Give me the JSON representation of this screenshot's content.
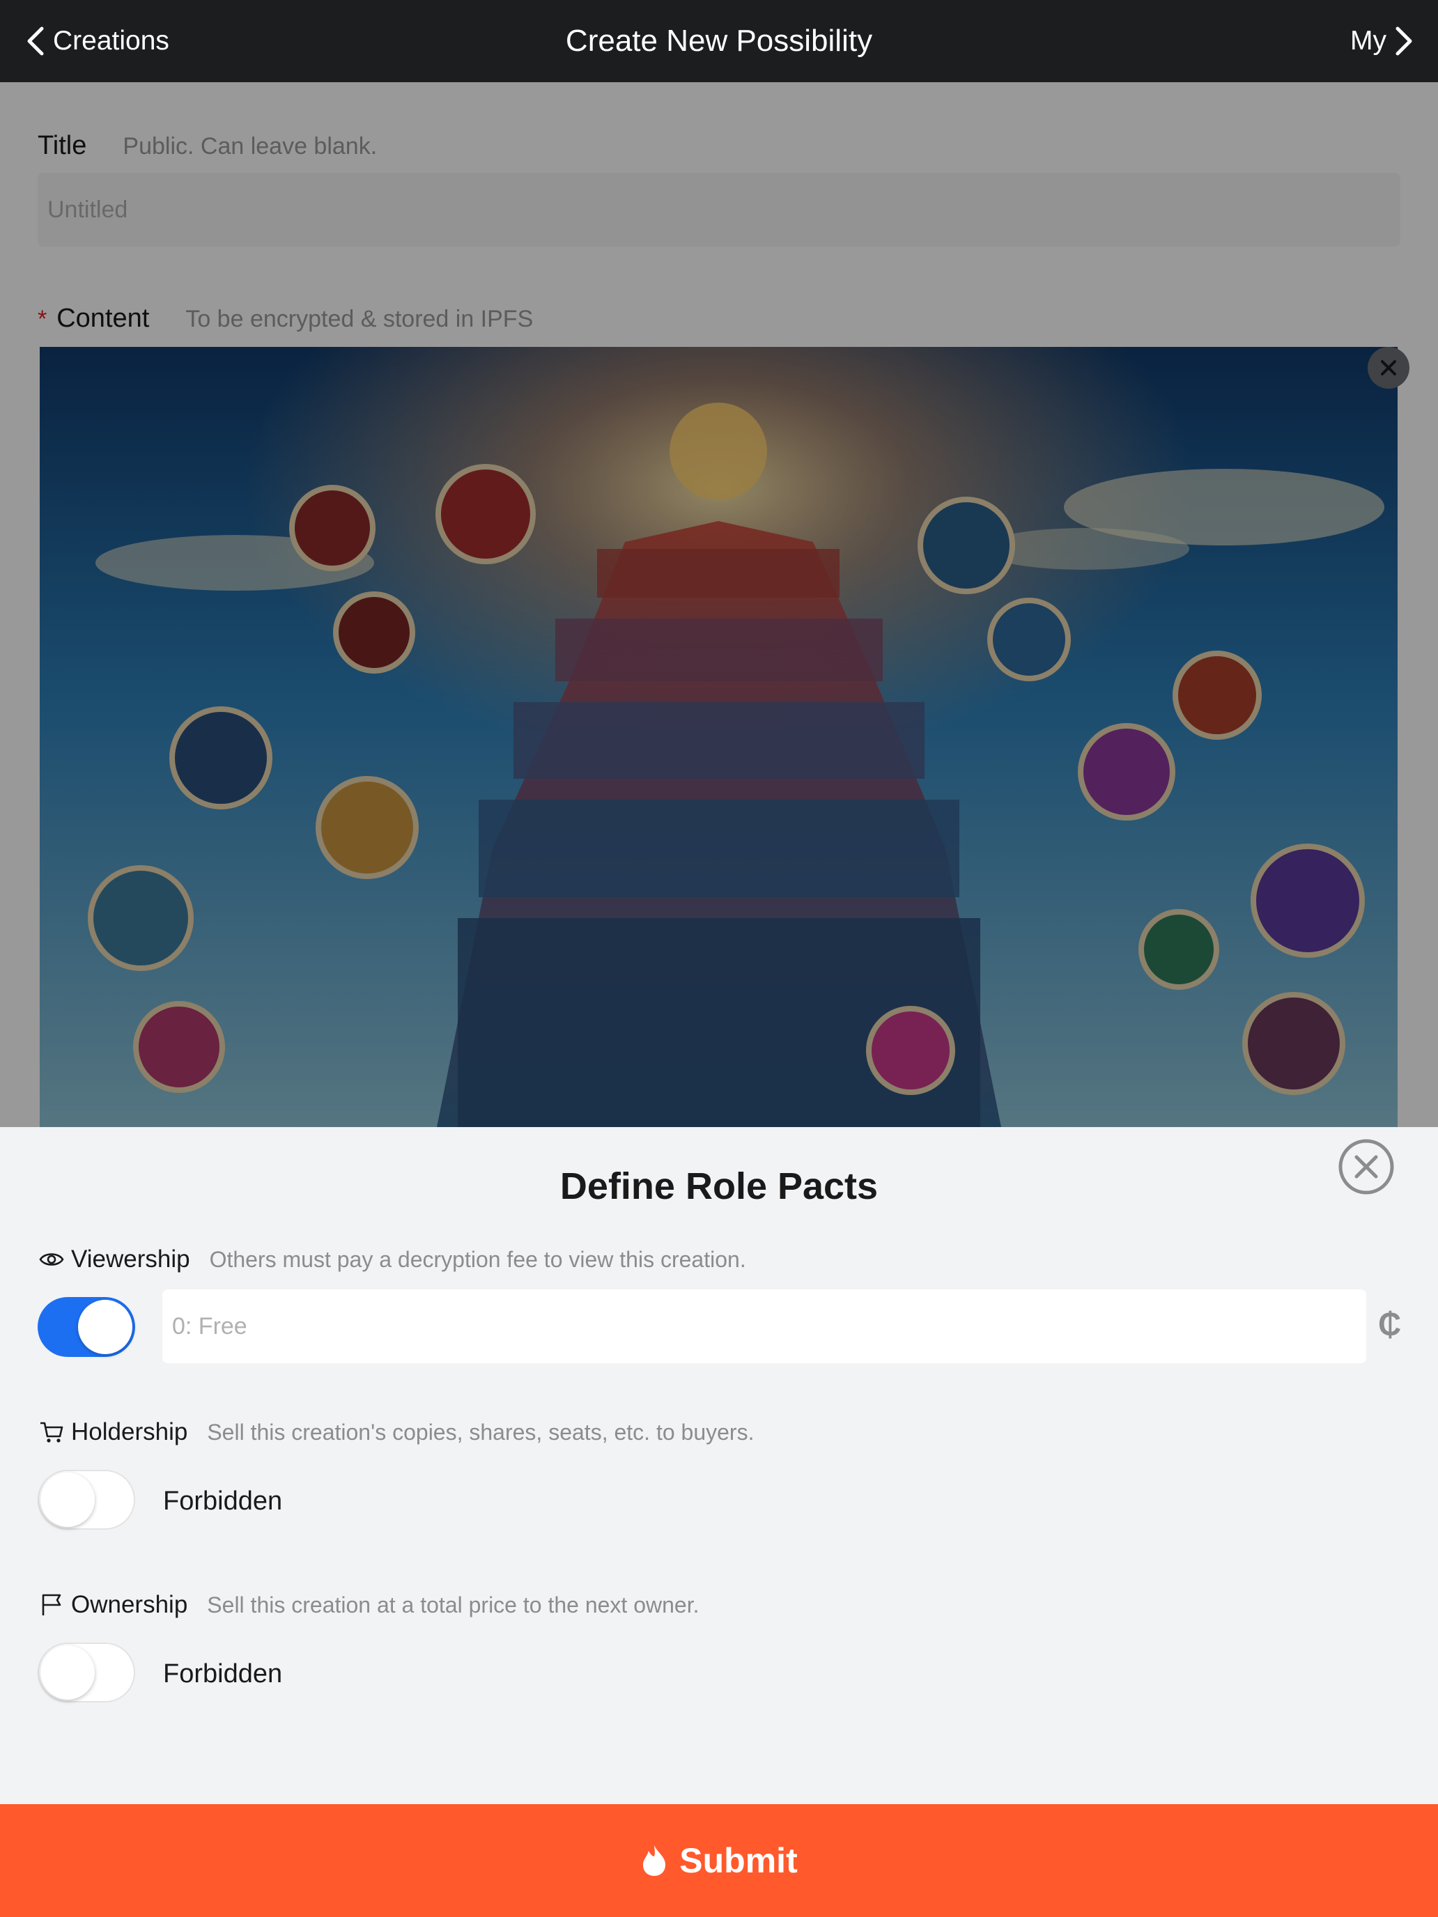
{
  "header": {
    "back_label": "Creations",
    "title": "Create New Possibility",
    "right_label": "My"
  },
  "form": {
    "title": {
      "label": "Title",
      "hint": "Public. Can leave blank.",
      "placeholder": "Untitled",
      "value": ""
    },
    "content": {
      "required_mark": "*",
      "label": "Content",
      "hint": "To be encrypted & stored in IPFS",
      "image_description_icon": "image-thumbnail"
    }
  },
  "sheet": {
    "title": "Define Role Pacts",
    "viewership": {
      "icon": "eye-icon",
      "label": "Viewership",
      "hint": "Others must pay a decryption fee to view this creation.",
      "enabled": true,
      "price_placeholder": "0: Free",
      "price_value": "",
      "currency": "₵"
    },
    "holdership": {
      "icon": "cart-icon",
      "label": "Holdership",
      "hint": "Sell this creation's copies, shares, seats, etc. to buyers.",
      "enabled": false,
      "state": "Forbidden"
    },
    "ownership": {
      "icon": "flag-icon",
      "label": "Ownership",
      "hint": "Sell this creation at a total price to the next owner.",
      "enabled": false,
      "state": "Forbidden"
    }
  },
  "submit": {
    "icon": "flame-icon",
    "label": "Submit"
  },
  "colors": {
    "navbar": "#1c1d1f",
    "accent_blue": "#1d6ff2",
    "submit_orange": "#ff592c",
    "sheet_bg": "#f2f3f5"
  }
}
